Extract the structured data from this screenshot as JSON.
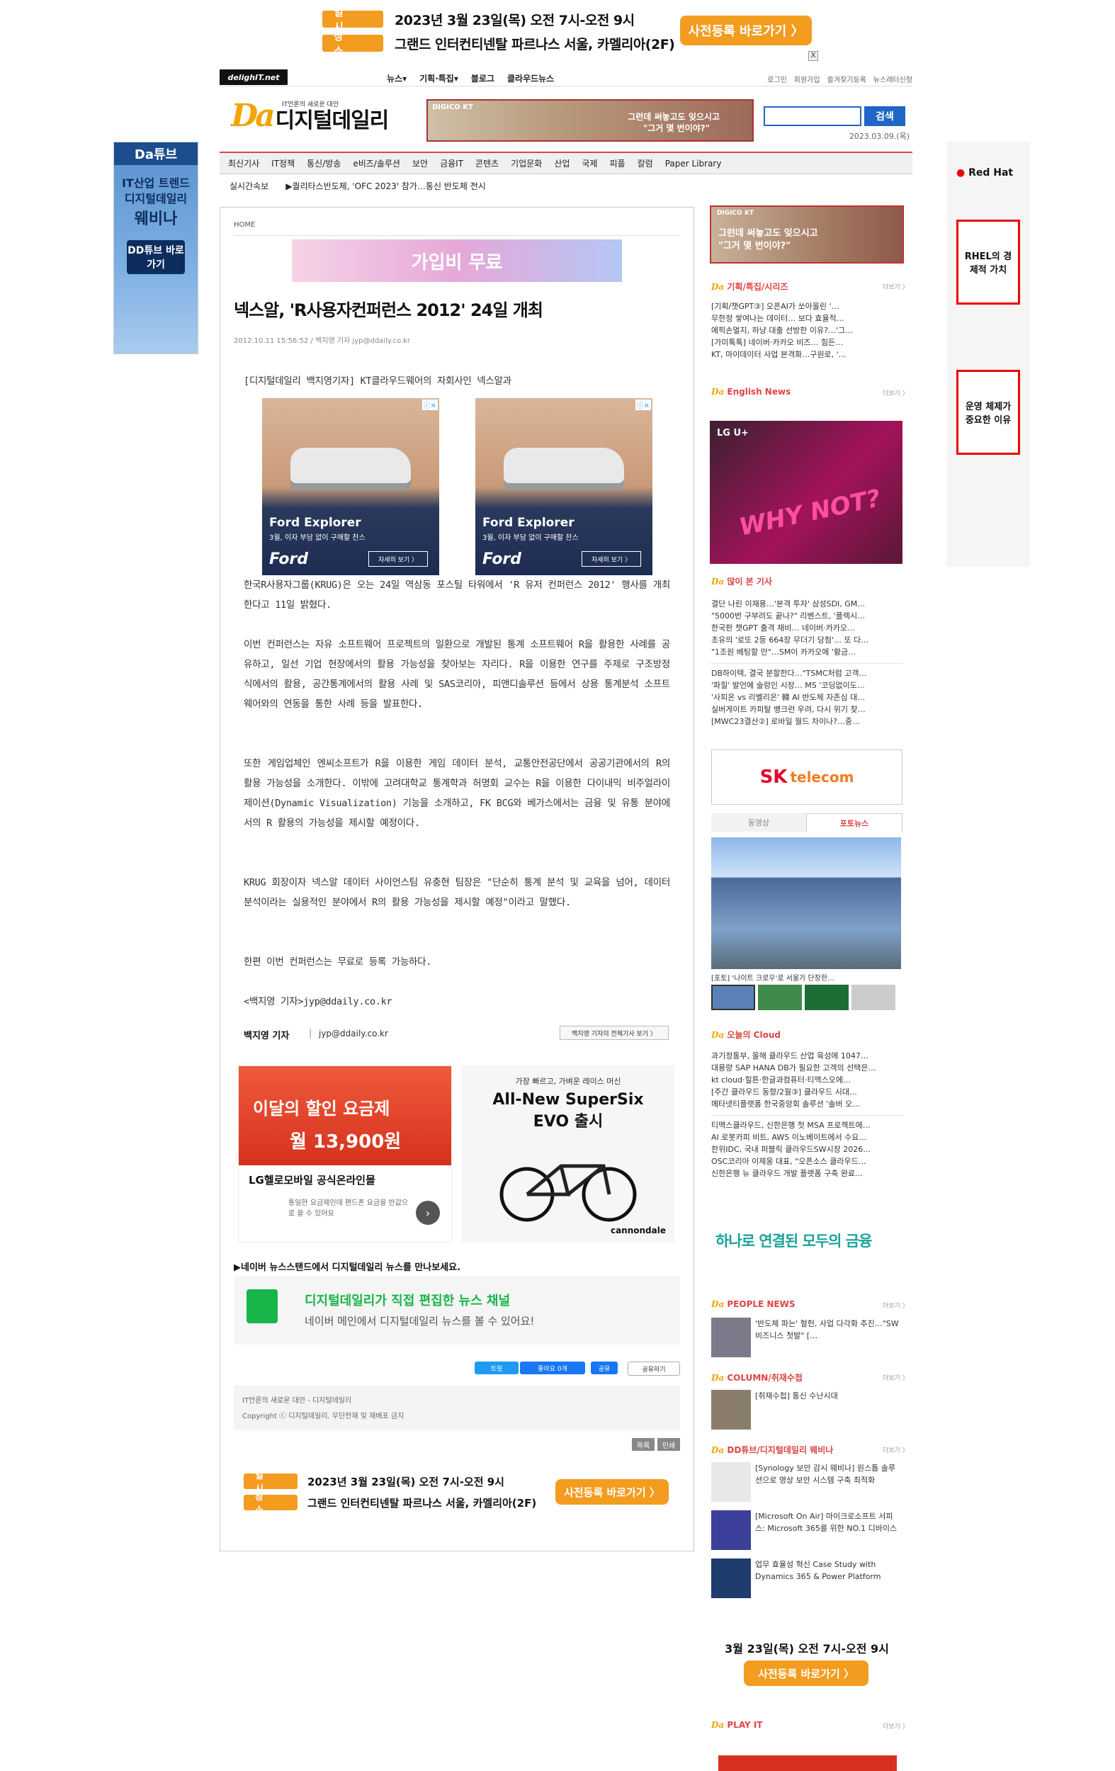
{
  "top_banner": {
    "row1_tag": "일 시",
    "row1_text": "2023년 3월 23일(목) 오전 7시-오전 9시",
    "row2_tag": "장 소",
    "row2_text": "그랜드 인터컨티넨탈 파르나스 서울, 카멜리아(2F)",
    "register_button": "사전등록 바로가기 〉",
    "close": "X"
  },
  "gnb": {
    "small_logo": "delighIT.net",
    "menu": [
      "뉴스▾",
      "기획·특집▾",
      "블로그",
      "클라우드뉴스"
    ],
    "right": [
      "로그인",
      "회원가입",
      "즐겨찾기등록",
      "뉴스레터신청"
    ]
  },
  "brand": {
    "tagline": "IT언론의 새로운 대안",
    "logo_da": "Da",
    "logo_name": "디지털데일리",
    "ad_brand": "DIGICO KT",
    "ad_line1": "그런데 써놓고도 잊으시고",
    "ad_line2": "\"그거 몇 번이야?\"",
    "search_button": "검색",
    "date": "2023.03.09.(목)"
  },
  "categories": [
    "최신기사",
    "IT정책",
    "통신/방송",
    "e비즈/솔루션",
    "보안",
    "금융IT",
    "콘텐츠",
    "기업문화",
    "산업",
    "국제",
    "피플",
    "칼럼",
    "Paper Library"
  ],
  "breaking": {
    "label": "실시간속보",
    "text": "▶퀄리타스반도체, 'OFC 2023' 참가…통신 반도체 전시"
  },
  "side_left": {
    "logo": "Da튜브",
    "line1": "IT산업 트렌드",
    "line2": "디지털데일리",
    "line3": "웨비나",
    "button": "DD튜브 바로가기"
  },
  "side_right": {
    "logo": "Red Hat",
    "card1": "RHEL의 경제적 가치",
    "card2": "운영 체제가 중요한 이유"
  },
  "article": {
    "breadcrumb": "HOME",
    "top_ad_text": "가입비 무료",
    "title": "넥스알, 'R사용자컨퍼런스 2012' 24일 개최",
    "meta": "2012.10.11 15:56:52 / 백지영 기자 jyp@ddaily.co.kr",
    "lead": "[디지털데일리 백지영기자] KT클라우드웨어의 자회사인 넥스알과",
    "paragraphs": [
      "한국R사용자그룹(KRUG)은 오는 24일 역삼동 포스틸 타워에서 'R 유저 컨퍼런스 2012' 행사를 개최한다고 11일 밝혔다.",
      "이번 컨퍼런스는 자유 소프트웨어 프로젝트의 일환으로 개발된 통계 소프트웨어 R을 활용한 사례를 공유하고, 일선 기업 현장에서의 활용 가능성을 찾아보는 자리다. R을 이용한 연구를 주제로 구조방정식에서의 활용, 공간통계에서의 활용 사례 및 SAS코리아, 피앤디솔루션 등에서 상용 통계분석 소프트웨어와의 연동을 통한 사례 등을 발표한다.",
      "또한 게임업체인 엔씨소프트가 R을 이용한 게임 데이터 분석, 교통안전공단에서 공공기관에서의 R의 활용 가능성을 소개한다. 이밖에 고려대학교 통계학과 허명회 교수는 R을 이용한 다이내믹 비주얼라이제이션(Dynamic Visualization) 기능을 소개하고, FK BCG와 베가스에서는 금융 및 유통 분야에서의 R 활용의 가능성을 제시할 예정이다.",
      "KRUG 회장이자 넥스알 데이터 사이언스팀 유충현 팀장은 \"단순히 통계 분석 및 교육을 넘어, 데이터 분석이라는 실용적인 분야에서 R의 활용 가능성을 제시할 예정\"이라고 말했다.",
      "한편 이번 컨퍼런스는 무료로 등록 가능하다.",
      "<백지영 기자>jyp@ddaily.co.kr"
    ],
    "author_name": "백지영 기자",
    "author_email": "jyp@ddaily.co.kr",
    "author_more": "백지영 기자의 전체기사 보기 〉",
    "ford_model": "Ford Explorer",
    "ford_sub": "3월, 이자 부담 없이 구매할 찬스",
    "ford_btn": "자세히 보기 〉",
    "ford_brand": "Ford",
    "ad2_title1": "이달의 할인 요금제",
    "ad2_price": "월 13,900원",
    "ad2_name": "LG헬로모바일 공식온라인몰",
    "ad2_desc": "통일한 요금제인데 편드폰 요금을 반값으로 쓸 수 있어요",
    "ad3_top": "가장 빠르고, 가벼운 레이스 머신",
    "ad3_title": "All-New SuperSix EVO 출시",
    "ad3_brand": "cannondale",
    "naver_line": "▶네이버 뉴스스탠드에서 디지털데일리 뉴스를 만나보세요.",
    "naver_title": "디지털데일리가 직접 편집한 뉴스 채널",
    "naver_sub": "네이버 메인에서 디지털데일리 뉴스를 볼 수 있어요!",
    "share": [
      "트윗",
      "좋아요 0개",
      "공유",
      "공유하기"
    ],
    "copyright1": "IT언론의 새로운 대안 - 디지털데일리",
    "copyright2": "Copyright ⓒ 디지털데일리. 무단전재 및 재배포 금지",
    "list_btn": "목록",
    "print_btn": "인쇄"
  },
  "right": {
    "ad_top_line1": "그런데 써놓고도 잊으시고",
    "ad_top_line2": "\"그거 몇 번이야?\"",
    "sec1": "기획/특집/시리즈",
    "sec1_items": [
      "[기획/챗GPT③] 오픈AI가 쏘아올린 '…",
      "무한정 쌓여나는 데이터… 보다 효율적…",
      "에픽손멀지, 하냥 대출 선방한 이유?…'그…",
      "[가미톡톡] 네이버·카카오 비즈… 힘든…",
      "KT, 마이데이터 사업 본격화…구원로, '…"
    ],
    "sec2": "English News",
    "sec3": "많이 본 기사",
    "sec3_items": [
      "결단 나린 이재용…'본격 투자' 삼성SDI, GM…",
      "\"5000번 구부려도 끝나?\" 리벤스트, '플렉시…",
      "한국판 챗GPT 출격 채비… 네이버·카카오…",
      "초유의 '로또 2등 664장 무더기 당첨'… 또 다…",
      "\"1조원 베팅할 만\"…SM이 카카오에 '황금…",
      "DB하이텍, 결국 분할한다…\"TSMC처럼 고객…",
      "'파힐' 발언에 술렁인 시장… MS '코딩없이도…",
      "'사피온 vs 리벨리온' 韓 AI 반도체 자존심 대…",
      "실버게이트 카피탈 뱅크런 우려, 다시 위기 찾…",
      "[MWC23결산②] 로바일 월드 차이나?…중…"
    ],
    "tab_video": "동영상",
    "tab_photo": "포토뉴스",
    "photo_caption": "[포토] '나이트 크로우'로 서울가 단장한…",
    "sec4": "오늘의 Cloud",
    "sec4_items": [
      "과기정통부, 올해 클라우드 산업 육성에 1047…",
      "대용량 SAP HANA DB가 필요한 고객의 선택은…",
      "kt cloud·힐튼·한글과컴퓨터·티맥스오에…",
      "[주간 클라우드 동향/2월③] 클라우드 시대…",
      "메타넷티플랫폼 한국중앙회 솔루션 '솔버 오…",
      "티맥스클라우드, 신한은행 첫 MSA 프로젝트에…",
      "AI 로봇카피 비트, AWS 이노베이트에서 수요…",
      "한위IDC, 국내 퍼블릭 클라우드SW시장 2026…",
      "OSC코리아 이제웅 대표, \"오픈소스 클라우드…",
      "신한은행 뉴 클라우드 개발 플랫폼 구축 완료…"
    ],
    "hana_ad": "하나로 연결된 모두의 금융",
    "sec5": "PEOPLE NEWS",
    "sec5_item": "'반도체 파는' 혈헌, 사업 다각화 추진…\"SW 비즈니스 첫발\" […",
    "sec6": "COLUMN/취재수첩",
    "sec6_item": "[취재수첩] 통신 수난시대",
    "sec7": "DD튜브/디지털데일리 웨비나",
    "sec7_items": [
      "[Synology 보안 감시 웨비나] 원스톱 솔루션으로 영상 보안 시스템 구축 최적화",
      "[Microsoft On Air] 마이크로소프트 서피스: Microsoft 365를 위한 NO.1 디바이스",
      "업무 효율성 혁신 Case Study with Dynamics 365 & Power Platform"
    ],
    "bottom_ad_line": "3월 23일(목) 오전 7시-오전 9시",
    "bottom_ad_btn": "사전등록 바로가기 〉",
    "sec8": "PLAY IT",
    "more": "더보기 〉"
  }
}
